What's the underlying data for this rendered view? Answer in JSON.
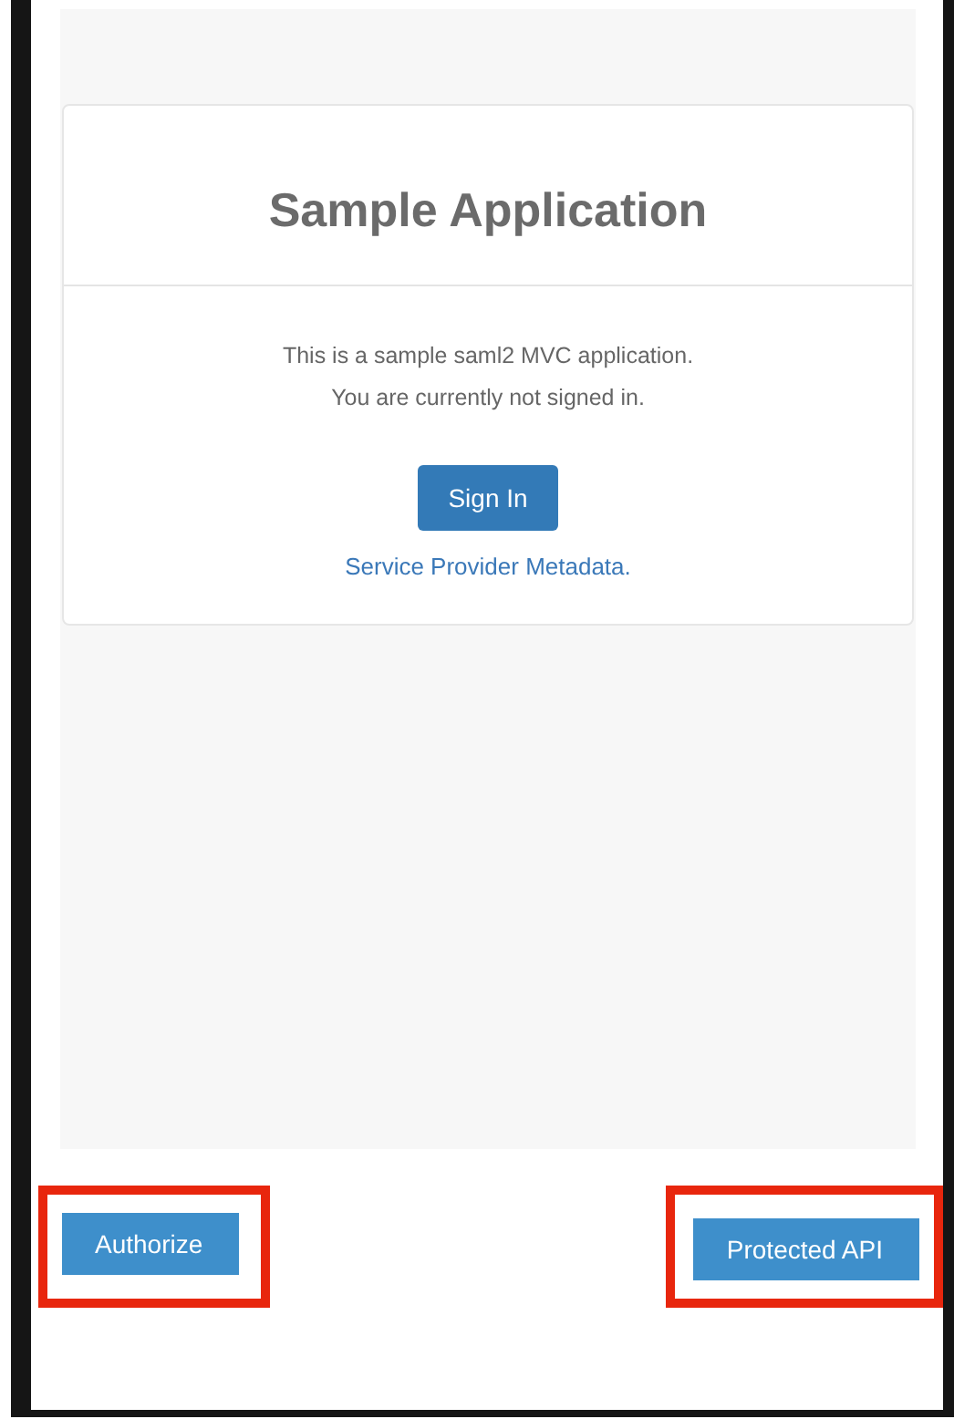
{
  "card": {
    "title": "Sample Application",
    "lines": [
      "This is a sample saml2 MVC application.",
      "You are currently not signed in."
    ],
    "button": "Sign In",
    "link": "Service Provider Metadata."
  },
  "bottom_buttons": [
    {
      "label": "Authorize",
      "highlighted": true
    },
    {
      "label": "Protected API",
      "highlighted": true
    }
  ]
}
